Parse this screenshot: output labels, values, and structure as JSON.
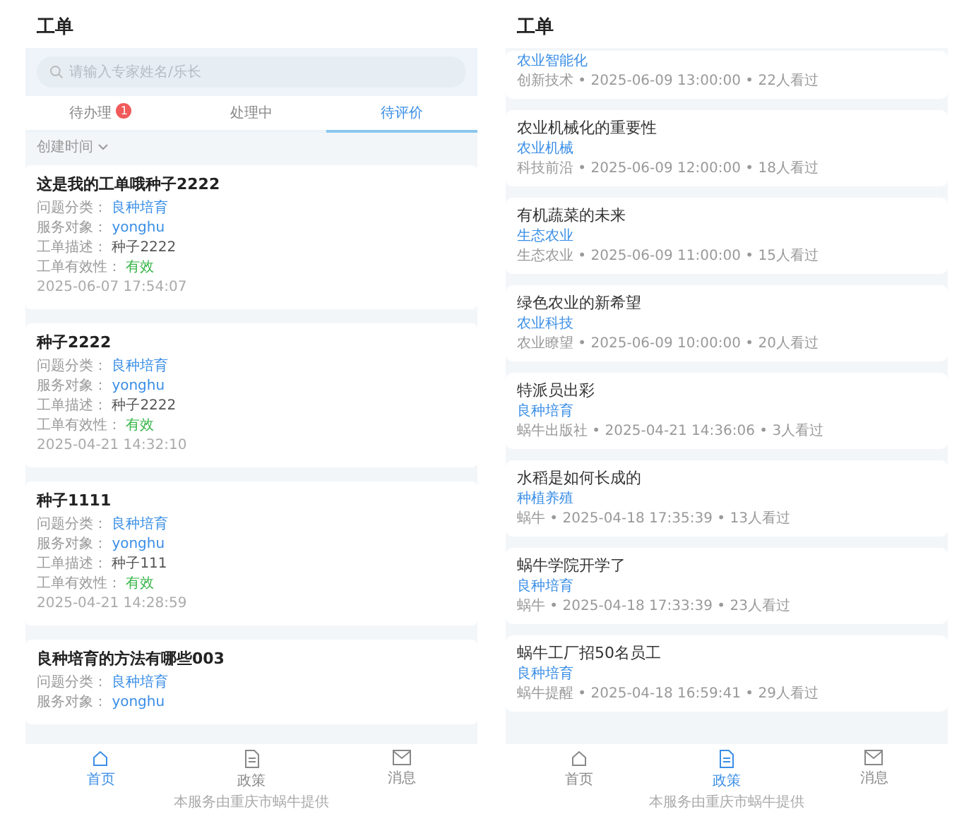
{
  "screens": [
    {
      "kind": "orders",
      "title": "工单",
      "search": {
        "placeholder": "请输入专家姓名/乐长"
      },
      "tabs": [
        {
          "label": "待办理",
          "badge": "1",
          "selected": false
        },
        {
          "label": "处理中",
          "selected": false
        },
        {
          "label": "待评价",
          "selected": true
        }
      ],
      "filter": "创建时间",
      "cards": [
        {
          "title": "这是我的工单哦种子2222",
          "fields": [
            {
              "label": "问题分类：",
              "value": "良种培育",
              "kind": "link"
            },
            {
              "label": "服务对象：",
              "value": "yonghu",
              "kind": "link"
            },
            {
              "label": "工单描述：",
              "value": "种子2222",
              "kind": "text"
            },
            {
              "label": "工单有效性：",
              "value": "有效",
              "kind": "status"
            }
          ],
          "date": "2025-06-07 17:54:07"
        },
        {
          "title": "种子2222",
          "fields": [
            {
              "label": "问题分类：",
              "value": "良种培育",
              "kind": "link"
            },
            {
              "label": "服务对象：",
              "value": "yonghu",
              "kind": "link"
            },
            {
              "label": "工单描述：",
              "value": "种子2222",
              "kind": "text"
            },
            {
              "label": "工单有效性：",
              "value": "有效",
              "kind": "status"
            }
          ],
          "date": "2025-04-21 14:32:10"
        },
        {
          "title": "种子1111",
          "fields": [
            {
              "label": "问题分类：",
              "value": "良种培育",
              "kind": "link"
            },
            {
              "label": "服务对象：",
              "value": "yonghu",
              "kind": "link"
            },
            {
              "label": "工单描述：",
              "value": "种子111",
              "kind": "text"
            },
            {
              "label": "工单有效性：",
              "value": "有效",
              "kind": "status"
            }
          ],
          "date": "2025-04-21 14:28:59"
        },
        {
          "title": "良种培育的方法有哪些003",
          "fields": [
            {
              "label": "问题分类：",
              "value": "良种培育",
              "kind": "link"
            },
            {
              "label": "服务对象：",
              "value": "yonghu",
              "kind": "link"
            }
          ]
        }
      ],
      "nav": [
        {
          "label": "首页",
          "selected": true
        },
        {
          "label": "政策",
          "selected": false
        },
        {
          "label": "消息",
          "selected": false
        }
      ],
      "footer": "本服务由重庆市蜗牛提供"
    },
    {
      "kind": "articles",
      "title": "工单",
      "articles": [
        {
          "tag": "农业智能化",
          "meta": "创新技术 • 2025-06-09 13:00:00 • 22人看过"
        },
        {
          "title": "农业机械化的重要性",
          "tag": "农业机械",
          "meta": "科技前沿 • 2025-06-09 12:00:00 • 18人看过"
        },
        {
          "title": "有机蔬菜的未来",
          "tag": "生态农业",
          "meta": "生态农业 • 2025-06-09 11:00:00 • 15人看过"
        },
        {
          "title": "绿色农业的新希望",
          "tag": "农业科技",
          "meta": "农业瞭望 • 2025-06-09 10:00:00 • 20人看过"
        },
        {
          "title": "特派员出彩",
          "tag": "良种培育",
          "meta": "蜗牛出版社 • 2025-04-21 14:36:06 • 3人看过"
        },
        {
          "title": "水稻是如何长成的",
          "tag": "种植养殖",
          "meta": "蜗牛 • 2025-04-18 17:35:39 • 13人看过"
        },
        {
          "title": "蜗牛学院开学了",
          "tag": "良种培育",
          "meta": "蜗牛 • 2025-04-18 17:33:39 • 23人看过"
        },
        {
          "title": "蜗牛工厂招50名员工",
          "tag": "良种培育",
          "meta": "蜗牛提醒 • 2025-04-18 16:59:41 • 29人看过"
        }
      ],
      "nav": [
        {
          "label": "首页",
          "selected": false
        },
        {
          "label": "政策",
          "selected": true
        },
        {
          "label": "消息",
          "selected": false
        }
      ],
      "footer": "本服务由重庆市蜗牛提供"
    }
  ]
}
